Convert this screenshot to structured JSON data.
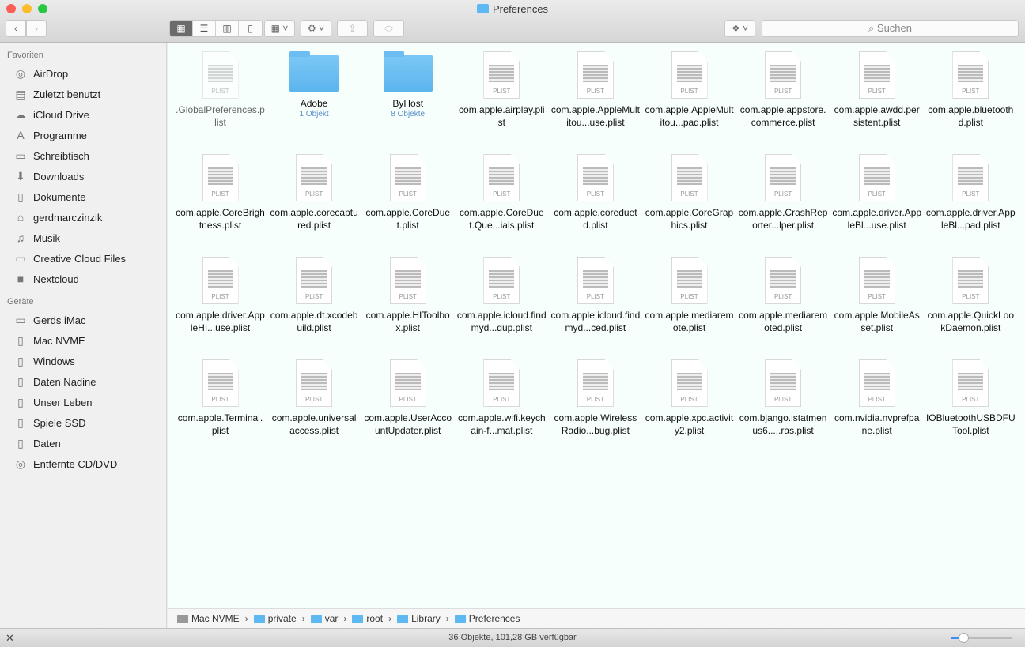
{
  "window": {
    "title": "Preferences"
  },
  "toolbar": {
    "search_placeholder": "Suchen"
  },
  "sidebar": {
    "favorites_header": "Favoriten",
    "favorites": [
      {
        "label": "AirDrop",
        "icon": "airdrop-icon",
        "glyph": "◎"
      },
      {
        "label": "Zuletzt benutzt",
        "icon": "recents-icon",
        "glyph": "▤"
      },
      {
        "label": "iCloud Drive",
        "icon": "cloud-icon",
        "glyph": "☁"
      },
      {
        "label": "Programme",
        "icon": "applications-icon",
        "glyph": "A"
      },
      {
        "label": "Schreibtisch",
        "icon": "desktop-icon",
        "glyph": "▭"
      },
      {
        "label": "Downloads",
        "icon": "downloads-icon",
        "glyph": "⬇"
      },
      {
        "label": "Dokumente",
        "icon": "documents-icon",
        "glyph": "▯"
      },
      {
        "label": "gerdmarczinzik",
        "icon": "home-icon",
        "glyph": "⌂"
      },
      {
        "label": "Musik",
        "icon": "music-icon",
        "glyph": "♫"
      },
      {
        "label": "Creative Cloud Files",
        "icon": "folder-icon",
        "glyph": "▭"
      },
      {
        "label": "Nextcloud",
        "icon": "folder-icon",
        "glyph": "■"
      }
    ],
    "devices_header": "Geräte",
    "devices": [
      {
        "label": "Gerds iMac",
        "icon": "imac-icon",
        "glyph": "▭"
      },
      {
        "label": "Mac NVME",
        "icon": "disk-icon",
        "glyph": "▯"
      },
      {
        "label": "Windows",
        "icon": "disk-icon",
        "glyph": "▯"
      },
      {
        "label": "Daten Nadine",
        "icon": "disk-icon",
        "glyph": "▯"
      },
      {
        "label": "Unser Leben",
        "icon": "disk-icon",
        "glyph": "▯"
      },
      {
        "label": "Spiele SSD",
        "icon": "disk-icon",
        "glyph": "▯"
      },
      {
        "label": "Daten",
        "icon": "disk-icon",
        "glyph": "▯"
      },
      {
        "label": "Entfernte CD/DVD",
        "icon": "disc-icon",
        "glyph": "◎"
      }
    ]
  },
  "files": [
    {
      "name": ".GlobalPreferences.plist",
      "type": "plist",
      "dim": true
    },
    {
      "name": "Adobe",
      "type": "folder",
      "sub": "1 Objekt"
    },
    {
      "name": "ByHost",
      "type": "folder",
      "sub": "8 Objekte"
    },
    {
      "name": "com.apple.airplay.plist",
      "type": "plist"
    },
    {
      "name": "com.apple.AppleMultitou...use.plist",
      "type": "plist"
    },
    {
      "name": "com.apple.AppleMultitou...pad.plist",
      "type": "plist"
    },
    {
      "name": "com.apple.appstore.commerce.plist",
      "type": "plist"
    },
    {
      "name": "com.apple.awdd.persistent.plist",
      "type": "plist"
    },
    {
      "name": "com.apple.bluetoothd.plist",
      "type": "plist"
    },
    {
      "name": "com.apple.CoreBrightness.plist",
      "type": "plist"
    },
    {
      "name": "com.apple.corecaptured.plist",
      "type": "plist"
    },
    {
      "name": "com.apple.CoreDuet.plist",
      "type": "plist"
    },
    {
      "name": "com.apple.CoreDuet.Que...ials.plist",
      "type": "plist"
    },
    {
      "name": "com.apple.coreduetd.plist",
      "type": "plist"
    },
    {
      "name": "com.apple.CoreGraphics.plist",
      "type": "plist"
    },
    {
      "name": "com.apple.CrashReporter...lper.plist",
      "type": "plist"
    },
    {
      "name": "com.apple.driver.AppleBl...use.plist",
      "type": "plist"
    },
    {
      "name": "com.apple.driver.AppleBl...pad.plist",
      "type": "plist"
    },
    {
      "name": "com.apple.driver.AppleHI...use.plist",
      "type": "plist"
    },
    {
      "name": "com.apple.dt.xcodebuild.plist",
      "type": "plist"
    },
    {
      "name": "com.apple.HIToolbox.plist",
      "type": "plist"
    },
    {
      "name": "com.apple.icloud.findmyd...dup.plist",
      "type": "plist"
    },
    {
      "name": "com.apple.icloud.findmyd...ced.plist",
      "type": "plist"
    },
    {
      "name": "com.apple.mediaremote.plist",
      "type": "plist"
    },
    {
      "name": "com.apple.mediaremoted.plist",
      "type": "plist"
    },
    {
      "name": "com.apple.MobileAsset.plist",
      "type": "plist"
    },
    {
      "name": "com.apple.QuickLookDaemon.plist",
      "type": "plist"
    },
    {
      "name": "com.apple.Terminal.plist",
      "type": "plist"
    },
    {
      "name": "com.apple.universalaccess.plist",
      "type": "plist"
    },
    {
      "name": "com.apple.UserAccountUpdater.plist",
      "type": "plist"
    },
    {
      "name": "com.apple.wifi.keychain-f...mat.plist",
      "type": "plist"
    },
    {
      "name": "com.apple.WirelessRadio...bug.plist",
      "type": "plist"
    },
    {
      "name": "com.apple.xpc.activity2.plist",
      "type": "plist"
    },
    {
      "name": "com.bjango.istatmenus6.....ras.plist",
      "type": "plist"
    },
    {
      "name": "com.nvidia.nvprefpane.plist",
      "type": "plist"
    },
    {
      "name": "IOBluetoothUSBDFUTool.plist",
      "type": "plist"
    }
  ],
  "plist_label": "PLIST",
  "pathbar": [
    "Mac NVME",
    "private",
    "var",
    "root",
    "Library",
    "Preferences"
  ],
  "status": {
    "text": "36 Objekte, 101,28 GB verfügbar",
    "icon_size": 0.2
  }
}
